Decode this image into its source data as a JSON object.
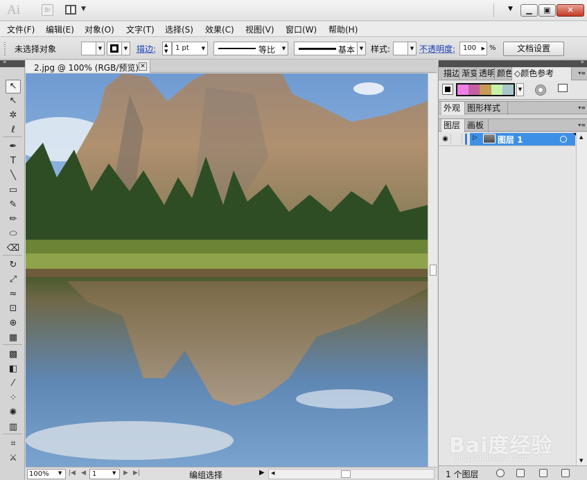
{
  "titlebar": {
    "app_logo": "Ai",
    "bridge_label": "Br",
    "icons": {
      "arrange": "arrange-documents-icon",
      "minimize": "minimize-icon",
      "maximize": "maximize-icon",
      "close": "close-icon"
    }
  },
  "menu": {
    "items": [
      "文件(F)",
      "编辑(E)",
      "对象(O)",
      "文字(T)",
      "选择(S)",
      "效果(C)",
      "视图(V)",
      "窗口(W)",
      "帮助(H)"
    ]
  },
  "control_bar": {
    "selection_label": "未选择对象",
    "stroke_label": "描边:",
    "stroke_weight": "1 pt",
    "variable_width_label": "等比",
    "brush_label": "基本",
    "style_label": "样式:",
    "opacity_label": "不透明度:",
    "opacity_value": "100",
    "opacity_unit": "%",
    "doc_setup_button": "文档设置"
  },
  "document": {
    "tab_label": "2.jpg @ 100% (RGB/预览)",
    "close_icon": "close-icon"
  },
  "tools": [
    {
      "icon": "selection-tool-icon",
      "glyph": "↖",
      "active": true
    },
    {
      "icon": "direct-selection-tool-icon",
      "glyph": "↖",
      "active": false
    },
    {
      "icon": "magic-wand-tool-icon",
      "glyph": "✲",
      "active": false
    },
    {
      "icon": "lasso-tool-icon",
      "glyph": "ℓ",
      "active": false
    },
    {
      "icon": "pen-tool-icon",
      "glyph": "✒",
      "active": false
    },
    {
      "icon": "type-tool-icon",
      "glyph": "T",
      "active": false
    },
    {
      "icon": "line-tool-icon",
      "glyph": "╲",
      "active": false
    },
    {
      "icon": "rectangle-tool-icon",
      "glyph": "▭",
      "active": false
    },
    {
      "icon": "paintbrush-tool-icon",
      "glyph": "✎",
      "active": false
    },
    {
      "icon": "pencil-tool-icon",
      "glyph": "✏",
      "active": false
    },
    {
      "icon": "blob-brush-tool-icon",
      "glyph": "⬭",
      "active": false
    },
    {
      "icon": "eraser-tool-icon",
      "glyph": "⌫",
      "active": false
    },
    {
      "icon": "rotate-tool-icon",
      "glyph": "↻",
      "active": false
    },
    {
      "icon": "scale-tool-icon",
      "glyph": "⤢",
      "active": false
    },
    {
      "icon": "warp-tool-icon",
      "glyph": "≈",
      "active": false
    },
    {
      "icon": "free-transform-tool-icon",
      "glyph": "⊡",
      "active": false
    },
    {
      "icon": "shape-builder-tool-icon",
      "glyph": "⊕",
      "active": false
    },
    {
      "icon": "perspective-grid-tool-icon",
      "glyph": "▦",
      "active": false
    },
    {
      "icon": "mesh-tool-icon",
      "glyph": "▩",
      "active": false
    },
    {
      "icon": "gradient-tool-icon",
      "glyph": "◧",
      "active": false
    },
    {
      "icon": "eyedropper-tool-icon",
      "glyph": "⁄",
      "active": false
    },
    {
      "icon": "blend-tool-icon",
      "glyph": "⁘",
      "active": false
    },
    {
      "icon": "symbol-sprayer-tool-icon",
      "glyph": "✺",
      "active": false
    },
    {
      "icon": "column-graph-tool-icon",
      "glyph": "▥",
      "active": false
    },
    {
      "icon": "artboard-tool-icon",
      "glyph": "⌗",
      "active": false
    },
    {
      "icon": "slice-tool-icon",
      "glyph": "⚔",
      "active": false
    }
  ],
  "panels": {
    "top_tabs": [
      "描边",
      "渐变",
      "透明",
      "颜色",
      "颜色参考"
    ],
    "active_top_tab": "颜色参考",
    "harmony_colors": [
      "#ee7fe6",
      "#c65fa4",
      "#c79a58",
      "#c9f0a9",
      "#a9c6cc"
    ],
    "appearance_tabs": [
      "外观",
      "图形样式"
    ],
    "layers_tabs": [
      "图层",
      "画板"
    ],
    "layer": {
      "name": "图层 1",
      "selection_color": "#3e8fe6"
    },
    "layers_count": "1 个图层",
    "footer_icons": [
      "make-clipping-mask-icon",
      "create-sublayer-icon",
      "create-layer-icon",
      "delete-layer-icon"
    ]
  },
  "status": {
    "zoom": "100%",
    "page": "1",
    "text": "编组选择"
  },
  "watermark": {
    "logo": "Bai度经验",
    "url": "jingyan.baidu.com"
  }
}
